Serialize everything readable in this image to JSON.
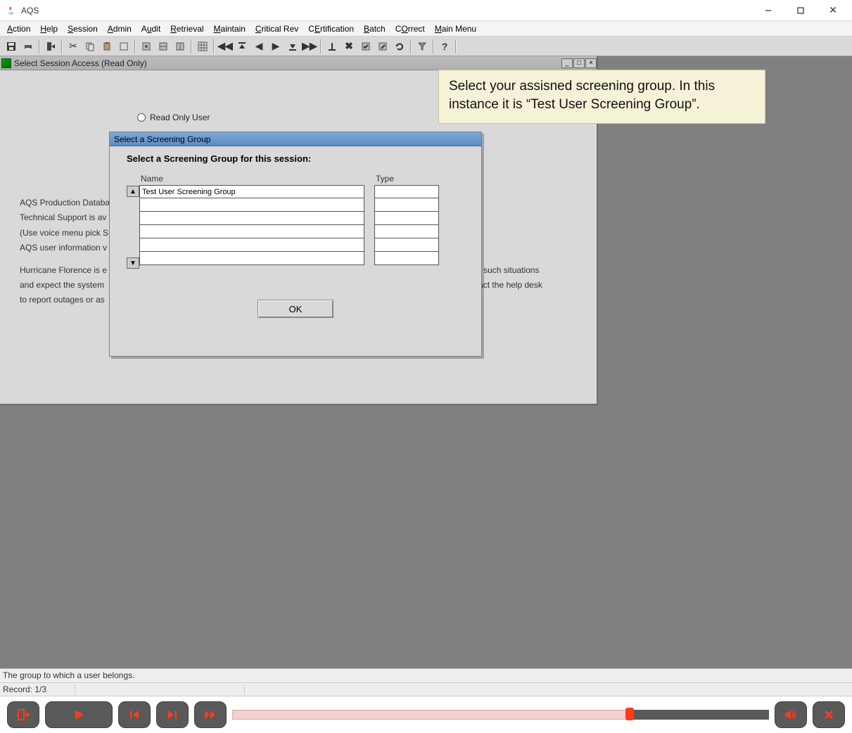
{
  "window": {
    "title": "AQS"
  },
  "menu": {
    "action": "Action",
    "help": "Help",
    "session": "Session",
    "admin": "Admin",
    "audit": "Audit",
    "retrieval": "Retrieval",
    "maintain": "Maintain",
    "critical": "Critical Rev",
    "certification": "CErtification",
    "batch": "Batch",
    "correct": "COrrect",
    "mainmenu": "Main Menu"
  },
  "session_window": {
    "title": "Select Session Access (Read Only)",
    "radio_label": "Read Only User",
    "bg_line1": "AQS Production Databa",
    "bg_line2": "Technical Support is av",
    "bg_line3": "(Use voice menu pick S",
    "bg_line4": "AQS user information v",
    "bg_line5": "Hurricane Florence is e",
    "bg_line5b": "ace for such situations",
    "bg_line6": "and expect the system",
    "bg_line6b": "y contact the help desk",
    "bg_line7": "to report outages or as"
  },
  "sg_dialog": {
    "title": "Select a Screening Group",
    "heading": "Select a Screening Group for this session:",
    "col_name": "Name",
    "col_type": "Type",
    "rows": [
      "Test User Screening Group",
      "",
      "",
      "",
      "",
      ""
    ],
    "types": [
      "",
      "",
      "",
      "",
      "",
      ""
    ],
    "ok": "OK"
  },
  "callout": {
    "text": "Select your assisned screening group. In this instance it is “Test User Screening Group”."
  },
  "status": {
    "line1": "The group to which a user belongs.",
    "record": "Record: 1/3"
  },
  "player": {
    "progress_pct": 74
  }
}
